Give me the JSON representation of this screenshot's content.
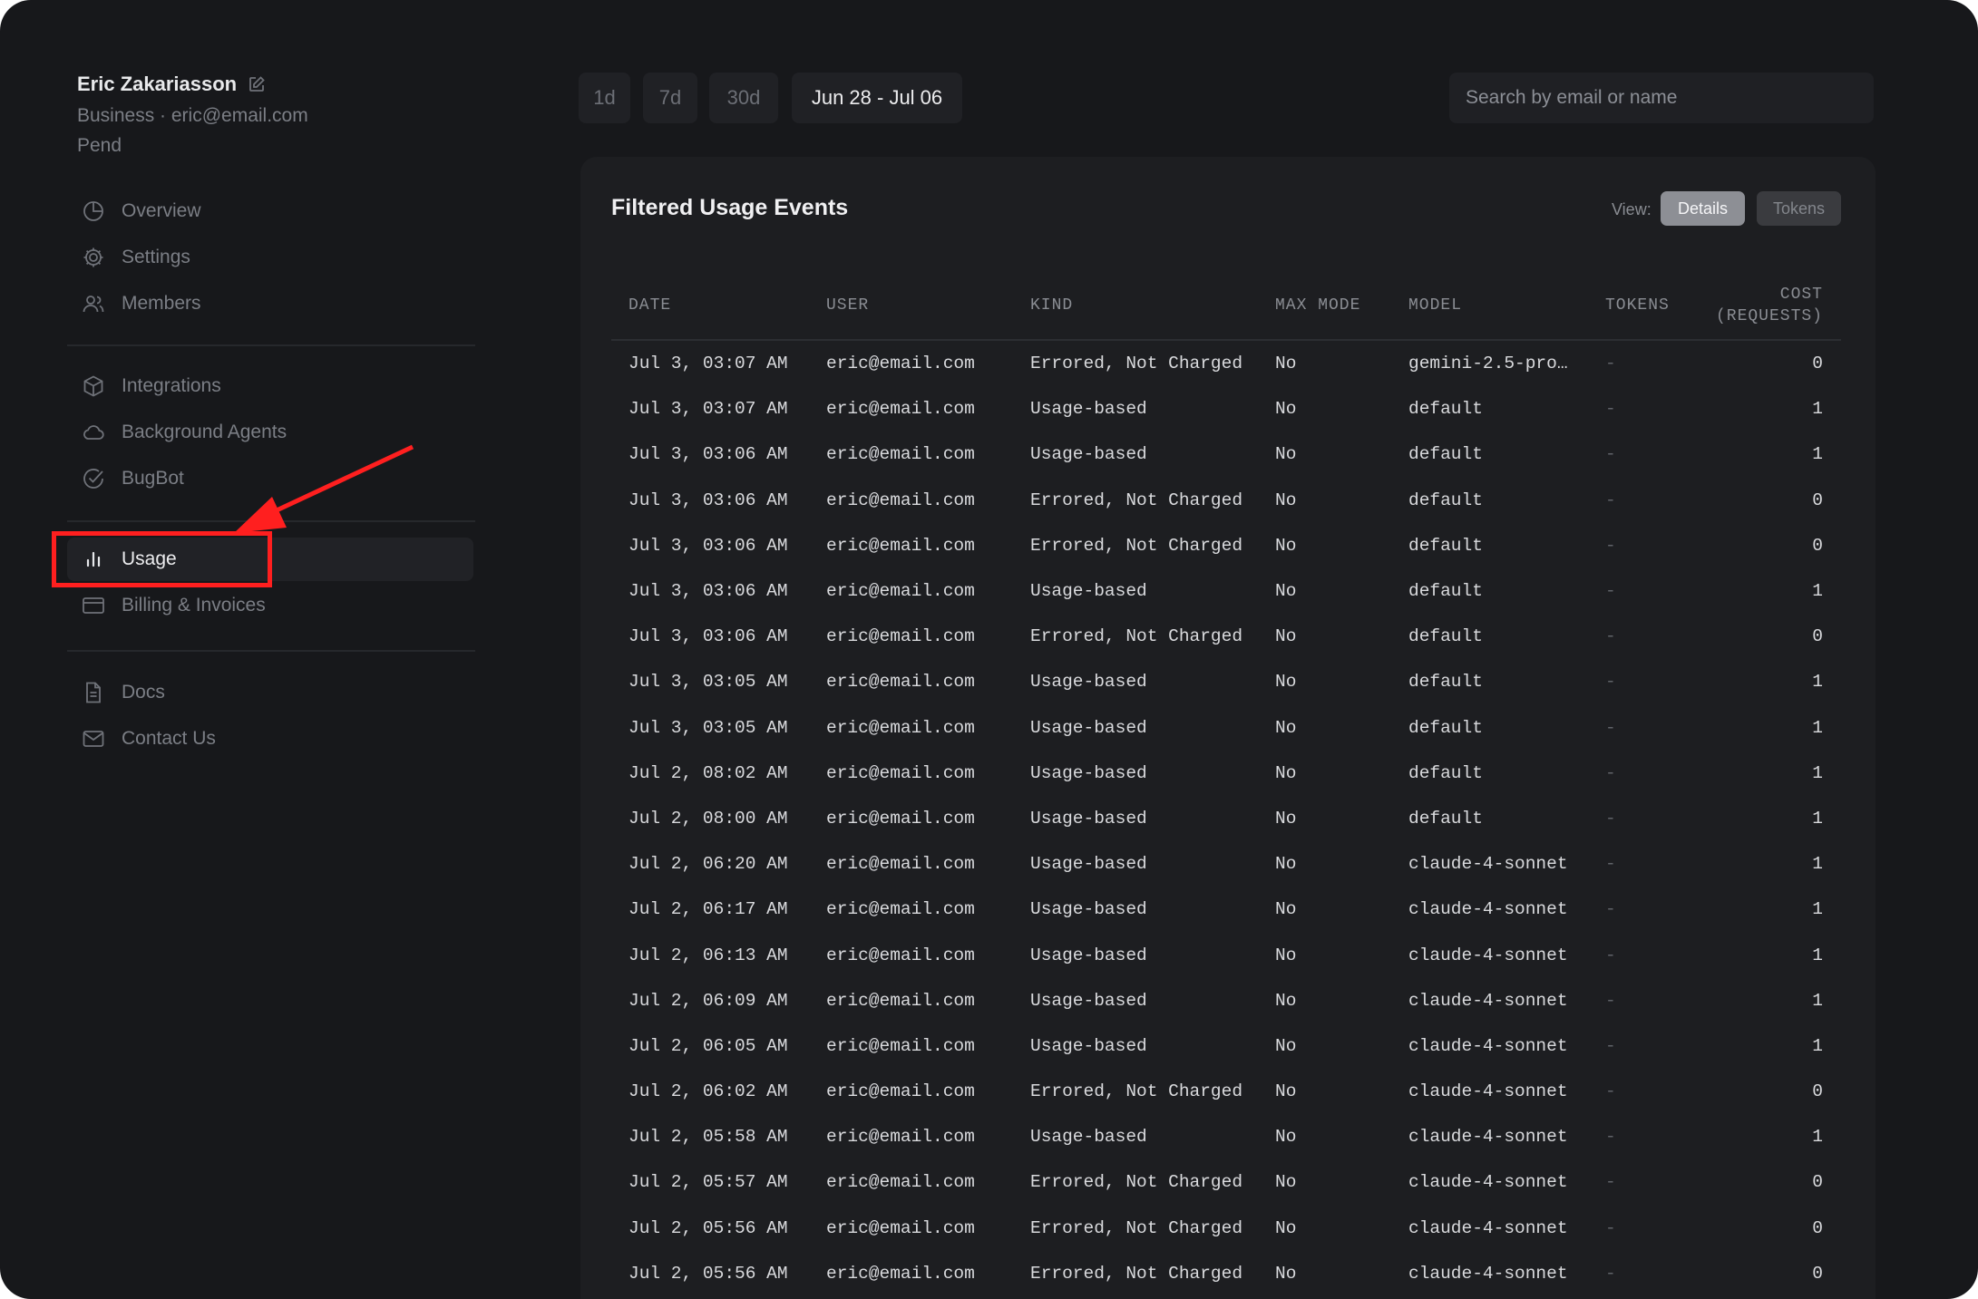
{
  "user": {
    "name": "Eric Zakariasson",
    "subtitle": "Business · eric@email.com",
    "status": "Pend"
  },
  "nav": {
    "group1": [
      {
        "label": "Overview",
        "icon": "pie-chart-icon"
      },
      {
        "label": "Settings",
        "icon": "gear-icon"
      },
      {
        "label": "Members",
        "icon": "users-icon"
      }
    ],
    "group2": [
      {
        "label": "Integrations",
        "icon": "cube-icon"
      },
      {
        "label": "Background Agents",
        "icon": "cloud-icon"
      },
      {
        "label": "BugBot",
        "icon": "check-circle-icon"
      }
    ],
    "group3": [
      {
        "label": "Usage",
        "icon": "bar-chart-icon",
        "active": true
      },
      {
        "label": "Billing & Invoices",
        "icon": "credit-card-icon"
      }
    ],
    "group4": [
      {
        "label": "Docs",
        "icon": "document-icon"
      },
      {
        "label": "Contact Us",
        "icon": "mail-icon"
      }
    ]
  },
  "toolbar": {
    "ranges": [
      "1d",
      "7d",
      "30d",
      "Jun 28 - Jul 06"
    ],
    "active_range": "Jun 28 - Jul 06",
    "search_placeholder": "Search by email or name"
  },
  "panel": {
    "title": "Filtered Usage Events",
    "view_label": "View:",
    "view_options": [
      "Details",
      "Tokens"
    ],
    "active_view": "Details"
  },
  "table": {
    "columns": [
      "DATE",
      "USER",
      "KIND",
      "MAX MODE",
      "MODEL",
      "TOKENS",
      "COST",
      "(REQUESTS)"
    ],
    "rows": [
      [
        "Jul 3, 03:07 AM",
        "eric@email.com",
        "Errored, Not Charged",
        "No",
        "gemini-2.5-pro…",
        "-",
        "0"
      ],
      [
        "Jul 3, 03:07 AM",
        "eric@email.com",
        "Usage-based",
        "No",
        "default",
        "-",
        "1"
      ],
      [
        "Jul 3, 03:06 AM",
        "eric@email.com",
        "Usage-based",
        "No",
        "default",
        "-",
        "1"
      ],
      [
        "Jul 3, 03:06 AM",
        "eric@email.com",
        "Errored, Not Charged",
        "No",
        "default",
        "-",
        "0"
      ],
      [
        "Jul 3, 03:06 AM",
        "eric@email.com",
        "Errored, Not Charged",
        "No",
        "default",
        "-",
        "0"
      ],
      [
        "Jul 3, 03:06 AM",
        "eric@email.com",
        "Usage-based",
        "No",
        "default",
        "-",
        "1"
      ],
      [
        "Jul 3, 03:06 AM",
        "eric@email.com",
        "Errored, Not Charged",
        "No",
        "default",
        "-",
        "0"
      ],
      [
        "Jul 3, 03:05 AM",
        "eric@email.com",
        "Usage-based",
        "No",
        "default",
        "-",
        "1"
      ],
      [
        "Jul 3, 03:05 AM",
        "eric@email.com",
        "Usage-based",
        "No",
        "default",
        "-",
        "1"
      ],
      [
        "Jul 2, 08:02 AM",
        "eric@email.com",
        "Usage-based",
        "No",
        "default",
        "-",
        "1"
      ],
      [
        "Jul 2, 08:00 AM",
        "eric@email.com",
        "Usage-based",
        "No",
        "default",
        "-",
        "1"
      ],
      [
        "Jul 2, 06:20 AM",
        "eric@email.com",
        "Usage-based",
        "No",
        "claude-4-sonnet",
        "-",
        "1"
      ],
      [
        "Jul 2, 06:17 AM",
        "eric@email.com",
        "Usage-based",
        "No",
        "claude-4-sonnet",
        "-",
        "1"
      ],
      [
        "Jul 2, 06:13 AM",
        "eric@email.com",
        "Usage-based",
        "No",
        "claude-4-sonnet",
        "-",
        "1"
      ],
      [
        "Jul 2, 06:09 AM",
        "eric@email.com",
        "Usage-based",
        "No",
        "claude-4-sonnet",
        "-",
        "1"
      ],
      [
        "Jul 2, 06:05 AM",
        "eric@email.com",
        "Usage-based",
        "No",
        "claude-4-sonnet",
        "-",
        "1"
      ],
      [
        "Jul 2, 06:02 AM",
        "eric@email.com",
        "Errored, Not Charged",
        "No",
        "claude-4-sonnet",
        "-",
        "0"
      ],
      [
        "Jul 2, 05:58 AM",
        "eric@email.com",
        "Usage-based",
        "No",
        "claude-4-sonnet",
        "-",
        "1"
      ],
      [
        "Jul 2, 05:57 AM",
        "eric@email.com",
        "Errored, Not Charged",
        "No",
        "claude-4-sonnet",
        "-",
        "0"
      ],
      [
        "Jul 2, 05:56 AM",
        "eric@email.com",
        "Errored, Not Charged",
        "No",
        "claude-4-sonnet",
        "-",
        "0"
      ],
      [
        "Jul 2, 05:56 AM",
        "eric@email.com",
        "Errored, Not Charged",
        "No",
        "claude-4-sonnet",
        "-",
        "0"
      ]
    ]
  },
  "colors": {
    "background": "#17181b",
    "panel": "#1d1e21",
    "highlight": "#ff1f1f"
  }
}
